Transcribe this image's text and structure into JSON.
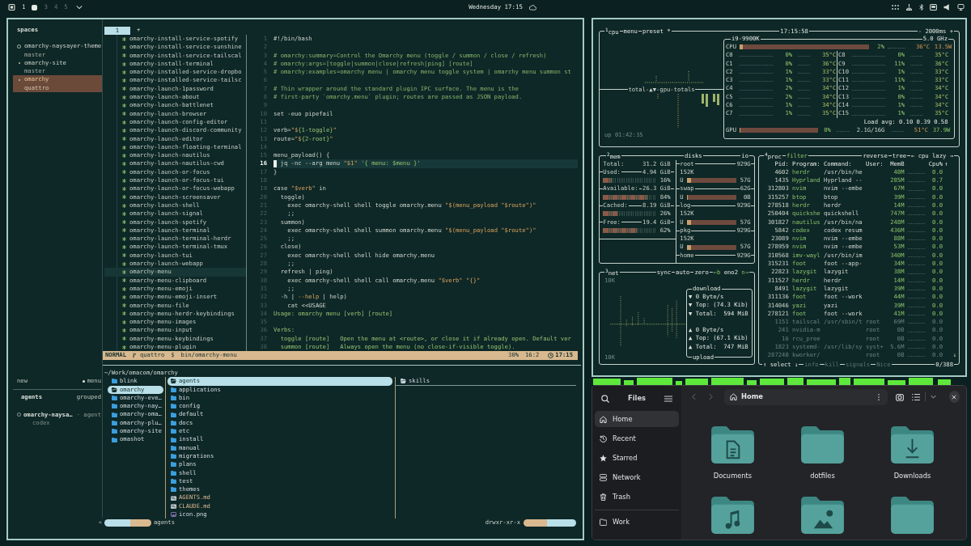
{
  "top_bar": {
    "workspaces": [
      {
        "label": "1",
        "selected": false,
        "occupied": true
      },
      {
        "selected": true
      },
      {
        "label": "3",
        "selected": false,
        "occupied": false
      },
      {
        "label": "4",
        "selected": false,
        "occupied": false
      },
      {
        "label": "5",
        "selected": false,
        "occupied": false
      }
    ],
    "clock": "Wednesday 17:15"
  },
  "terminal": {
    "spaces": {
      "title": "spaces",
      "items": [
        {
          "name": "omarchy-naysayer-theme",
          "branch": "master",
          "kind": "ring",
          "selected": false
        },
        {
          "name": "omarchy-site",
          "branch": "master",
          "kind": "dot",
          "selected": false
        },
        {
          "name": "omarchy",
          "branch": "quattro",
          "kind": "dot",
          "selected": true
        }
      ]
    },
    "new_label": "new",
    "menu_label": "menu",
    "agents": {
      "title": "agents",
      "mode": "grouped",
      "items": [
        {
          "name": "omarchy-naysa…",
          "tag": "· agent",
          "detail": "codex"
        }
      ]
    },
    "nvim": {
      "tabs": [
        {
          "label": "1",
          "selected": true
        }
      ],
      "new_tab": "+",
      "tree": [
        {
          "name": "omarchy-install-service-spotify",
          "selected": false
        },
        {
          "name": "omarchy-install-service-sunshine",
          "selected": false
        },
        {
          "name": "omarchy-install-service-tailscal",
          "selected": false
        },
        {
          "name": "omarchy-install-terminal",
          "selected": false
        },
        {
          "name": "omarchy-installed-service-dropbo",
          "selected": false
        },
        {
          "name": "omarchy-installed-service-tailsc",
          "selected": false
        },
        {
          "name": "omarchy-launch-1password",
          "selected": false
        },
        {
          "name": "omarchy-launch-about",
          "selected": false
        },
        {
          "name": "omarchy-launch-battlenet",
          "selected": false
        },
        {
          "name": "omarchy-launch-browser",
          "selected": false
        },
        {
          "name": "omarchy-launch-config-editor",
          "selected": false
        },
        {
          "name": "omarchy-launch-discord-community",
          "selected": false
        },
        {
          "name": "omarchy-launch-editor",
          "selected": false
        },
        {
          "name": "omarchy-launch-floating-terminal",
          "selected": false
        },
        {
          "name": "omarchy-launch-nautilus",
          "selected": false
        },
        {
          "name": "omarchy-launch-nautilus-cwd",
          "selected": false
        },
        {
          "name": "omarchy-launch-or-focus",
          "selected": false
        },
        {
          "name": "omarchy-launch-or-focus-tui",
          "selected": false
        },
        {
          "name": "omarchy-launch-or-focus-webapp",
          "selected": false
        },
        {
          "name": "omarchy-launch-screensaver",
          "selected": false
        },
        {
          "name": "omarchy-launch-shell",
          "selected": false
        },
        {
          "name": "omarchy-launch-signal",
          "selected": false
        },
        {
          "name": "omarchy-launch-spotify",
          "selected": false
        },
        {
          "name": "omarchy-launch-terminal",
          "selected": false
        },
        {
          "name": "omarchy-launch-terminal-herdr",
          "selected": false
        },
        {
          "name": "omarchy-launch-terminal-tmux",
          "selected": false
        },
        {
          "name": "omarchy-launch-tui",
          "selected": false
        },
        {
          "name": "omarchy-launch-webapp",
          "selected": false
        },
        {
          "name": "omarchy-menu",
          "selected": true
        },
        {
          "name": "omarchy-menu-clipboard",
          "selected": false
        },
        {
          "name": "omarchy-menu-emoji",
          "selected": false
        },
        {
          "name": "omarchy-menu-emoji-insert",
          "selected": false
        },
        {
          "name": "omarchy-menu-file",
          "selected": false
        },
        {
          "name": "omarchy-menu-herdr-keybindings",
          "selected": false
        },
        {
          "name": "omarchy-menu-images",
          "selected": false
        },
        {
          "name": "omarchy-menu-input",
          "selected": false
        },
        {
          "name": "omarchy-menu-keybindings",
          "selected": false
        },
        {
          "name": "omarchy-menu-plugin",
          "selected": false
        }
      ],
      "lines": [
        {
          "number": "1",
          "current": false,
          "tokens": [
            {
              "kind": "plain",
              "text": "#!/bin/bash"
            }
          ]
        },
        {
          "number": "2",
          "current": false
        },
        {
          "number": "3",
          "current": false,
          "tokens": [
            {
              "kind": "comment",
              "text": "# omarchy:summary=Control the Omarchy menu (toggle / summon / close / refresh)"
            }
          ]
        },
        {
          "number": "4",
          "current": false,
          "tokens": [
            {
              "kind": "comment",
              "text": "# omarchy:args=[toggle|summon|close|refresh|ping] [route]"
            }
          ]
        },
        {
          "number": "5",
          "current": false,
          "tokens": [
            {
              "kind": "comment",
              "text": "# omarchy:examples=omarchy menu | omarchy menu toggle system | omarchy menu summon st"
            }
          ]
        },
        {
          "number": "6",
          "current": false
        },
        {
          "number": "7",
          "current": false,
          "tokens": [
            {
              "kind": "comment",
              "text": "# Thin wrapper around the standard plugin IPC surface. The menu is the"
            }
          ]
        },
        {
          "number": "8",
          "current": false,
          "tokens": [
            {
              "kind": "comment",
              "text": "# first-party `omarchy.menu` plugin; routes are passed as JSON payload."
            }
          ]
        },
        {
          "number": "9",
          "current": false
        },
        {
          "number": "10",
          "current": false,
          "tokens": [
            {
              "kind": "plain",
              "text": "set -euo pipefail"
            }
          ]
        },
        {
          "number": "11",
          "current": false
        },
        {
          "number": "12",
          "current": false,
          "tokens": [
            {
              "kind": "plain",
              "text": "verb="
            },
            {
              "kind": "string",
              "text": "\"$"
            },
            {
              "kind": "literal",
              "text": "{1-toggle}"
            },
            {
              "kind": "string",
              "text": "\""
            }
          ]
        },
        {
          "number": "13",
          "current": false,
          "tokens": [
            {
              "kind": "plain",
              "text": "route="
            },
            {
              "kind": "string",
              "text": "\"$"
            },
            {
              "kind": "literal",
              "text": "{2-root}"
            },
            {
              "kind": "string",
              "text": "\""
            }
          ]
        },
        {
          "number": "14",
          "current": false
        },
        {
          "number": "15",
          "current": false,
          "tokens": [
            {
              "kind": "plain",
              "text": "menu_payload() {"
            }
          ]
        },
        {
          "number": "16",
          "current": true,
          "tokens": [
            {
              "kind": "plain",
              "text": " jq -nc --arg menu "
            },
            {
              "kind": "string",
              "text": "\"$1\""
            },
            {
              "kind": "literal",
              "text": " '{ menu: $menu }'"
            }
          ]
        },
        {
          "number": "17",
          "current": false,
          "tokens": [
            {
              "kind": "plain",
              "text": "}"
            }
          ]
        },
        {
          "number": "18",
          "current": false
        },
        {
          "number": "19",
          "current": false,
          "tokens": [
            {
              "kind": "plain",
              "text": "case "
            },
            {
              "kind": "string",
              "text": "\"$verb\""
            },
            {
              "kind": "plain",
              "text": " in"
            }
          ]
        },
        {
          "number": "20",
          "current": false,
          "tokens": [
            {
              "kind": "plain",
              "text": "  toggle)"
            }
          ]
        },
        {
          "number": "21",
          "current": false,
          "tokens": [
            {
              "kind": "plain",
              "text": "    exec omarchy-shell shell toggle omarchy.menu "
            },
            {
              "kind": "string",
              "text": "\"$(menu_payload \"$route\")\""
            }
          ]
        },
        {
          "number": "22",
          "current": false,
          "tokens": [
            {
              "kind": "plain",
              "text": "    ;;"
            }
          ]
        },
        {
          "number": "23",
          "current": false,
          "tokens": [
            {
              "kind": "plain",
              "text": "  summon)"
            }
          ]
        },
        {
          "number": "24",
          "current": false,
          "tokens": [
            {
              "kind": "plain",
              "text": "    exec omarchy-shell shell summon omarchy.menu "
            },
            {
              "kind": "string",
              "text": "\"$(menu_payload \"$route\")\""
            }
          ]
        },
        {
          "number": "25",
          "current": false,
          "tokens": [
            {
              "kind": "plain",
              "text": "    ;;"
            }
          ]
        },
        {
          "number": "26",
          "current": false,
          "tokens": [
            {
              "kind": "plain",
              "text": "  close)"
            }
          ]
        },
        {
          "number": "27",
          "current": false,
          "tokens": [
            {
              "kind": "plain",
              "text": "    exec omarchy-shell shell hide omarchy.menu"
            }
          ]
        },
        {
          "number": "28",
          "current": false,
          "tokens": [
            {
              "kind": "plain",
              "text": "    ;;"
            }
          ]
        },
        {
          "number": "29",
          "current": false,
          "tokens": [
            {
              "kind": "plain",
              "text": "  refresh | ping)"
            }
          ]
        },
        {
          "number": "30",
          "current": false,
          "tokens": [
            {
              "kind": "plain",
              "text": "    exec omarchy-shell shell call omarchy.menu "
            },
            {
              "kind": "string",
              "text": "\"$verb\" \"{}\""
            }
          ]
        },
        {
          "number": "31",
          "current": false,
          "tokens": [
            {
              "kind": "plain",
              "text": "    ;;"
            }
          ]
        },
        {
          "number": "32",
          "current": false,
          "tokens": [
            {
              "kind": "plain",
              "text": "  -h | "
            },
            {
              "kind": "string",
              "text": "--help"
            },
            {
              "kind": "plain",
              "text": " | help)"
            }
          ]
        },
        {
          "number": "33",
          "current": false,
          "tokens": [
            {
              "kind": "plain",
              "text": "    cat <<USAGE"
            }
          ]
        },
        {
          "number": "34",
          "current": false,
          "tokens": [
            {
              "kind": "literal",
              "text": "Usage: omarchy menu [verb] [route]"
            }
          ]
        },
        {
          "number": "35",
          "current": false
        },
        {
          "number": "36",
          "current": false,
          "tokens": [
            {
              "kind": "literal",
              "text": "Verbs:"
            }
          ]
        },
        {
          "number": "37",
          "current": false,
          "tokens": [
            {
              "kind": "literal",
              "text": "  toggle [route]   Open the menu at <route>, or close it if already open. Default ver"
            }
          ]
        },
        {
          "number": "38",
          "current": false,
          "tokens": [
            {
              "kind": "literal",
              "text": "  summon [route]   Always open the menu (no close-if-visible toggle)."
            }
          ]
        }
      ],
      "status": {
        "mode": "NORMAL",
        "branch": "quattro",
        "prompt": "$",
        "file": "bin/omarchy-menu",
        "percent": "30%",
        "position": "16:2",
        "time": "17:15"
      }
    },
    "yazi": {
      "path": "~/Work/omacom/omarchy",
      "parent": [
        {
          "name": "blink",
          "selected": false
        },
        {
          "name": "omarchy",
          "selected": true
        },
        {
          "name": "omarchy-eve…",
          "selected": false
        },
        {
          "name": "omarchy-nay…",
          "selected": false
        },
        {
          "name": "omarchy-oma…",
          "selected": false
        },
        {
          "name": "omarchy-plu…",
          "selected": false
        },
        {
          "name": "omarchy-site",
          "selected": false
        },
        {
          "name": "omashot",
          "selected": false
        }
      ],
      "current": [
        {
          "name": "agents",
          "kind": "dir",
          "selected": true
        },
        {
          "name": "applications",
          "kind": "dir",
          "selected": false
        },
        {
          "name": "bin",
          "kind": "dir",
          "selected": false
        },
        {
          "name": "config",
          "kind": "dir",
          "selected": false
        },
        {
          "name": "default",
          "kind": "dir",
          "selected": false
        },
        {
          "name": "docs",
          "kind": "dir",
          "selected": false
        },
        {
          "name": "etc",
          "kind": "dir",
          "selected": false
        },
        {
          "name": "install",
          "kind": "dir",
          "selected": false
        },
        {
          "name": "manual",
          "kind": "dir",
          "selected": false
        },
        {
          "name": "migrations",
          "kind": "dir",
          "selected": false
        },
        {
          "name": "plans",
          "kind": "dir",
          "selected": false
        },
        {
          "name": "shell",
          "kind": "dir",
          "selected": false
        },
        {
          "name": "test",
          "kind": "dir",
          "selected": false
        },
        {
          "name": "themes",
          "kind": "dir",
          "selected": false
        },
        {
          "name": "AGENTS.md",
          "kind": "markdown",
          "selected": false
        },
        {
          "name": "CLAUDE.md",
          "kind": "markdown",
          "selected": false
        },
        {
          "name": "icon.png",
          "kind": "image",
          "selected": false
        }
      ],
      "preview": [
        {
          "name": "skills",
          "kind": "dir",
          "selected": true
        }
      ],
      "status": {
        "back": "«",
        "name": "agents",
        "permissions": "drwxr-xr-x"
      }
    }
  },
  "btop": {
    "cpu": {
      "tabs": [
        "$^{1}$cpu",
        "menu",
        "preset *"
      ],
      "time": "17:15:58",
      "interval": "- 2000ms +",
      "graph_label": "total-▲▼-gpu-totals",
      "uptime": "up 01:42:35",
      "model": "i9-9900K",
      "frequency": "5.0 GHz",
      "total": {
        "label": "CPU",
        "level": 0.02,
        "percent": "2%",
        "temp": "36°C",
        "power": "13.5W"
      },
      "cores": [
        {
          "label": "C0",
          "percent": "0%",
          "temp": "35°C"
        },
        {
          "label": "C1",
          "percent": "0%",
          "temp": "36°C"
        },
        {
          "label": "C2",
          "percent": "1%",
          "temp": "33°C"
        },
        {
          "label": "C3",
          "percent": "1%",
          "temp": "33°C"
        },
        {
          "label": "C4",
          "percent": "2%",
          "temp": "34°C"
        },
        {
          "label": "C5",
          "percent": "2%",
          "temp": "34°C"
        },
        {
          "label": "C6",
          "percent": "1%",
          "temp": "34°C"
        },
        {
          "label": "C7",
          "percent": "1%",
          "temp": "35°C"
        },
        {
          "label": "C8",
          "percent": "0%",
          "temp": "35°C"
        },
        {
          "label": "C9",
          "percent": "11%",
          "temp": "36°C"
        },
        {
          "label": "C10",
          "percent": "1%",
          "temp": "33°C"
        },
        {
          "label": "C11",
          "percent": "11%",
          "temp": "33°C"
        },
        {
          "label": "C12",
          "percent": "1%",
          "temp": "34°C"
        },
        {
          "label": "C13",
          "percent": "0%",
          "temp": "34°C"
        },
        {
          "label": "C14",
          "percent": "1%",
          "temp": "34°C"
        },
        {
          "label": "C15",
          "percent": "1%",
          "temp": "35°C"
        }
      ],
      "load": "Load avg: 0.10 0.39 0.58",
      "gpu": {
        "label": "GPU",
        "level": 0,
        "percent": "0%",
        "memory": "2.1G/16G",
        "temp": "51°C",
        "power": "37.9W"
      }
    },
    "mem": {
      "title": "$^{2}$mem",
      "rows": [
        {
          "label": "Total:",
          "value": "31.2 GiB"
        },
        {
          "label": "Used:",
          "value": "4.94 GiB",
          "percent": "16%",
          "level": 0.16
        },
        {
          "label": "Available:",
          "value": "26.3 GiB",
          "percent": "84%",
          "level": 0.84
        },
        {
          "label": "Cached:",
          "value": "8.19 GiB",
          "percent": "26%",
          "level": 0.26
        },
        {
          "label": "Free:",
          "value": "19.4 GiB",
          "percent": "62%",
          "level": 0.62
        }
      ]
    },
    "disks": {
      "title": "disks",
      "io_title": "io",
      "items": [
        {
          "name": "root",
          "size": "929G",
          "io": "152K",
          "used_label": "U",
          "used": "57G",
          "level": 0.06
        },
        {
          "name": "swap",
          "size": "62G",
          "used_label": "U",
          "used": "0B",
          "level": 0
        },
        {
          "name": "log",
          "size": "929G",
          "io": "152K",
          "used_label": "U",
          "used": "57G",
          "level": 0.06
        },
        {
          "name": "pkg",
          "size": "929G",
          "io": "152K",
          "used_label": "U",
          "used": "57G",
          "level": 0.06
        },
        {
          "name": "home",
          "size": "929G"
        }
      ]
    },
    "net": {
      "title": "$^{3}$net",
      "buttons": [
        "sync",
        "auto",
        "zero"
      ],
      "prev": "←b",
      "interface": "eno2",
      "next": "n→",
      "scale_top": "10K",
      "scale_bottom": "10K",
      "download": {
        "title": "download",
        "rows": [
          "▼ 0 Byte/s",
          "▼ Top: (74.3 Kib)",
          "▼ Total:  594 MiB"
        ]
      },
      "upload": {
        "title": "upload",
        "rows": [
          "▲ 0 Byte/s",
          "▲ Top: (67.1 Kib)",
          "▲ Total:  747 MiB"
        ]
      }
    },
    "proc": {
      "title": "$^{4}$proc",
      "filter": "filter",
      "options": [
        "reverse",
        "tree"
      ],
      "sort": "← cpu lazy →",
      "columns": [
        "Pid:",
        "Program:",
        "Command:",
        "User:",
        "MemB",
        "Cpu%"
      ],
      "scroll_up": "↑",
      "scroll_down": "↓",
      "rows": [
        {
          "pid": "4602",
          "program": "herdr",
          "command": "/usr/bin/he",
          "mem": "48M",
          "cpu": "0.0",
          "dim": false
        },
        {
          "pid": "1435",
          "program": "Hyprland",
          "command": "Hyprland --",
          "mem": "285M",
          "cpu": "0.7",
          "dim": false
        },
        {
          "pid": "312803",
          "program": "nvim",
          "command": "nvim --embe",
          "mem": "67M",
          "cpu": "0.0",
          "dim": false
        },
        {
          "pid": "315257",
          "program": "btop",
          "command": "btop",
          "mem": "39M",
          "cpu": "0.0",
          "dim": false
        },
        {
          "pid": "278518",
          "program": "herdr",
          "command": "herdr",
          "mem": "14M",
          "cpu": "0.0",
          "dim": false
        },
        {
          "pid": "250404",
          "program": "quickshe",
          "command": "quickshell",
          "mem": "747M",
          "cpu": "0.0",
          "dim": false
        },
        {
          "pid": "301827",
          "program": "nautilus",
          "command": "/usr/bin/na",
          "mem": "248M",
          "cpu": "0.0",
          "dim": false
        },
        {
          "pid": "5842",
          "program": "codex",
          "command": "codex resum",
          "mem": "436M",
          "cpu": "0.0",
          "dim": false
        },
        {
          "pid": "23089",
          "program": "nvim",
          "command": "nvim --embe",
          "mem": "88M",
          "cpu": "0.0",
          "dim": false
        },
        {
          "pid": "278959",
          "program": "nvim",
          "command": "nvim --embe",
          "mem": "53M",
          "cpu": "0.0",
          "dim": false
        },
        {
          "pid": "310568",
          "program": "imv-wayl",
          "command": "/usr/bin/im",
          "mem": "340M",
          "cpu": "0.0",
          "dim": false
        },
        {
          "pid": "315231",
          "program": "foot",
          "command": "foot --app-",
          "mem": "34M",
          "cpu": "0.0",
          "dim": false
        },
        {
          "pid": "22823",
          "program": "lazygit",
          "command": "lazygit",
          "mem": "38M",
          "cpu": "0.0",
          "dim": false
        },
        {
          "pid": "311527",
          "program": "herdr",
          "command": "herdr",
          "mem": "14M",
          "cpu": "0.0",
          "dim": false
        },
        {
          "pid": "8491",
          "program": "lazygit",
          "command": "lazygit",
          "mem": "39M",
          "cpu": "0.0",
          "dim": false
        },
        {
          "pid": "311136",
          "program": "foot",
          "command": "foot --work",
          "mem": "44M",
          "cpu": "0.0",
          "dim": false
        },
        {
          "pid": "314046",
          "program": "yazi",
          "command": "yazi",
          "mem": "39M",
          "cpu": "0.0",
          "dim": false
        },
        {
          "pid": "278121",
          "program": "foot",
          "command": "foot --work",
          "mem": "41M",
          "cpu": "0.0",
          "dim": false
        },
        {
          "pid": "1151",
          "program": "tailscal",
          "command": "/usr/sbin/t",
          "user": "root",
          "mem": "69M",
          "cpu": "0.0",
          "dim": true
        },
        {
          "pid": "241",
          "program": "nvidia-m",
          "user": "root",
          "mem": "0B",
          "cpu": "0.0",
          "dim": true
        },
        {
          "pid": "16",
          "program": "rcu_pree",
          "user": "root",
          "mem": "0B",
          "cpu": "0.0",
          "dim": true
        },
        {
          "pid": "1823",
          "program": "systemd-",
          "command": "/usr/lib/sy",
          "user": "syst+",
          "mem": "5.6M",
          "cpu": "0.0",
          "dim": true
        },
        {
          "pid": "287240",
          "program": "kworker/",
          "user": "root",
          "mem": "0B",
          "cpu": "0.0",
          "dim": true
        }
      ],
      "footer": [
        {
          "label": "↑ select ↓",
          "disabled": false
        },
        {
          "label": "info",
          "disabled": true
        },
        {
          "label": "kill",
          "disabled": true
        },
        {
          "label": "signals",
          "disabled": true
        },
        {
          "label": "Nice",
          "disabled": true
        }
      ],
      "count": "0/388"
    }
  },
  "files": {
    "title": "Files",
    "places": [
      {
        "label": "Home",
        "kind": "home",
        "selected": true
      },
      {
        "label": "Recent",
        "kind": "recent",
        "selected": false
      },
      {
        "label": "Starred",
        "kind": "starred",
        "selected": false
      },
      {
        "label": "Network",
        "kind": "network",
        "selected": false
      },
      {
        "label": "Trash",
        "kind": "trash",
        "selected": false
      }
    ],
    "bookmarks": [
      {
        "label": "Work",
        "kind": "folder",
        "selected": false
      }
    ],
    "location": "Home",
    "items": [
      {
        "name": "Documents",
        "kind": "documents"
      },
      {
        "name": "dotfiles",
        "kind": "folder"
      },
      {
        "name": "Downloads",
        "kind": "downloads"
      },
      {
        "kind": "music"
      },
      {
        "kind": "pictures"
      },
      {
        "kind": "folder"
      }
    ]
  }
}
